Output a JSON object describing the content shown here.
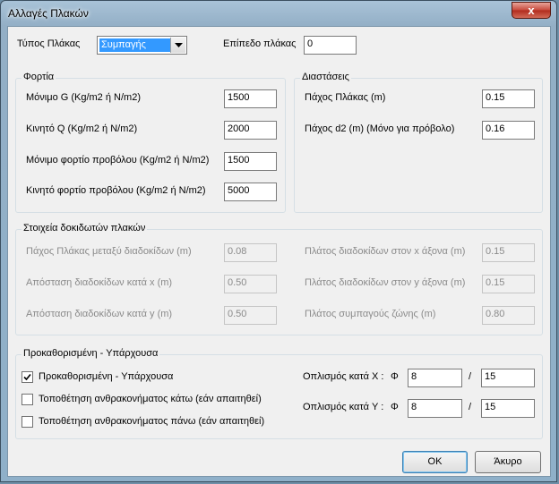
{
  "window": {
    "title": "Αλλαγές Πλακών",
    "close_glyph": "x"
  },
  "slab_type": {
    "label": "Τύπος Πλάκας",
    "value": "Συμπαγής"
  },
  "slab_level": {
    "label": "Επίπεδο πλάκας",
    "value": "0"
  },
  "loads": {
    "title": "Φορτία",
    "rows": [
      {
        "label": "Μόνιμο G (Kg/m2 ή N/m2)",
        "value": "1500"
      },
      {
        "label": "Κινητό Q (Kg/m2  ή N/m2)",
        "value": "2000"
      },
      {
        "label": "Μόνιμο φορτίο προβόλου (Kg/m2 ή N/m2)",
        "value": "1500"
      },
      {
        "label": "Κινητό φορτίο προβόλου (Kg/m2 ή N/m2)",
        "value": "5000"
      }
    ]
  },
  "dimensions": {
    "title": "Διαστάσεις",
    "rows": [
      {
        "label": "Πάχος Πλάκας (m)",
        "value": "0.15"
      },
      {
        "label": "Πάχος d2 (m) (Μόνο για πρόβολο)",
        "value": "0.16"
      }
    ]
  },
  "ribbed": {
    "title": "Στοιχεία δοκιδωτών πλακών",
    "left": [
      {
        "label": "Πάχος Πλάκας μεταξύ διαδοκίδων (m)",
        "value": "0.08"
      },
      {
        "label": "Απόσταση διαδοκίδων κατά x (m)",
        "value": "0.50"
      },
      {
        "label": "Απόσταση διαδοκίδων κατά y (m)",
        "value": "0.50"
      }
    ],
    "right": [
      {
        "label": "Πλάτος διαδοκίδων στον x άξονα (m)",
        "value": "0.15"
      },
      {
        "label": "Πλάτος διαδοκίδων στον y άξονα (m)",
        "value": "0.15"
      },
      {
        "label": "Πλάτος συμπαγούς ζώνης (m)",
        "value": "0.80"
      }
    ]
  },
  "predefined": {
    "title": "Προκαθορισμένη - Υπάρχουσα",
    "checkboxes": [
      {
        "label": "Προκαθορισμένη - Υπάρχουσα",
        "checked": true
      },
      {
        "label": "Τοποθέτηση ανθρακονήματος κάτω (εάν απαιτηθεί)",
        "checked": false
      },
      {
        "label": "Τοποθέτηση ανθρακονήματος πάνω (εάν απαιτηθεί)",
        "checked": false
      }
    ],
    "reinf_x": {
      "label": "Οπλισμός κατά X :",
      "phi": "Φ",
      "diameter": "8",
      "slash": "/",
      "spacing": "15"
    },
    "reinf_y": {
      "label": "Οπλισμός κατά Y :",
      "phi": "Φ",
      "diameter": "8",
      "slash": "/",
      "spacing": "15"
    }
  },
  "buttons": {
    "ok": "OK",
    "cancel": "Άκυρο"
  }
}
